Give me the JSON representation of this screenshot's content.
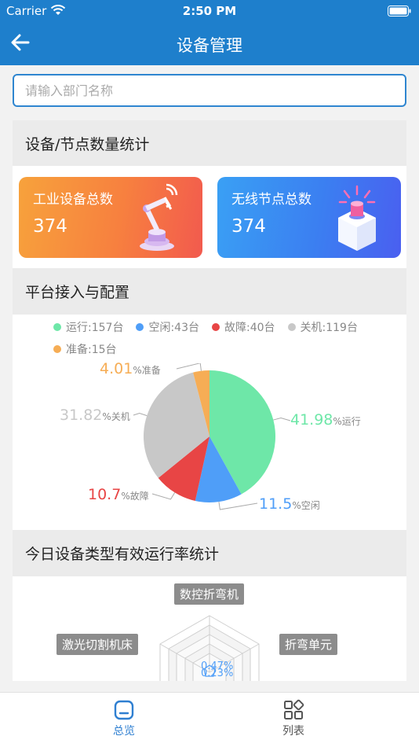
{
  "status_bar": {
    "carrier": "Carrier",
    "time": "2:50 PM"
  },
  "header": {
    "title": "设备管理",
    "back_icon": "arrow-left-icon"
  },
  "search": {
    "placeholder": "请输入部门名称",
    "value": ""
  },
  "device_stats": {
    "title": "设备/节点数量统计",
    "cards": [
      {
        "label": "工业设备总数",
        "value": "374",
        "icon": "robot-arm-icon"
      },
      {
        "label": "无线节点总数",
        "value": "374",
        "icon": "wireless-node-cube-icon"
      }
    ]
  },
  "platform": {
    "title": "平台接入与配置",
    "legend": [
      {
        "label": "运行:157台",
        "color": "#6ee7a8"
      },
      {
        "label": "空闲:43台",
        "color": "#4f9ef8"
      },
      {
        "label": "故障:40台",
        "color": "#e84545"
      },
      {
        "label": "关机:119台",
        "color": "#c8c8c8"
      },
      {
        "label": "准备:15台",
        "color": "#f6ad55"
      }
    ]
  },
  "chart_data": {
    "type": "pie",
    "title": "",
    "series": [
      {
        "name": "运行",
        "value": 41.98,
        "count": 157,
        "color": "#6ee7a8",
        "label_num": "41.98",
        "label_unit": "%运行"
      },
      {
        "name": "空闲",
        "value": 11.5,
        "count": 43,
        "color": "#4f9ef8",
        "label_num": "11.5",
        "label_unit": "%空闲"
      },
      {
        "name": "故障",
        "value": 10.7,
        "count": 40,
        "color": "#e84545",
        "label_num": "10.7",
        "label_unit": "%故障"
      },
      {
        "name": "关机",
        "value": 31.82,
        "count": 119,
        "color": "#c8c8c8",
        "label_num": "31.82",
        "label_unit": "%关机"
      },
      {
        "name": "准备",
        "value": 4.01,
        "count": 15,
        "color": "#f6ad55",
        "label_num": "4.01",
        "label_unit": "%准备"
      }
    ]
  },
  "efficiency": {
    "title": "今日设备类型有效运行率统计",
    "radar_axes": [
      "数控折弯机",
      "折弯单元",
      "激光切割机床"
    ],
    "radar_values": [
      "0.47%",
      "0.23%"
    ]
  },
  "tabbar": {
    "active_color": "#2f7fd1",
    "tabs": [
      {
        "label": "总览",
        "icon": "overview-icon"
      },
      {
        "label": "列表",
        "icon": "grid-list-icon"
      }
    ]
  }
}
